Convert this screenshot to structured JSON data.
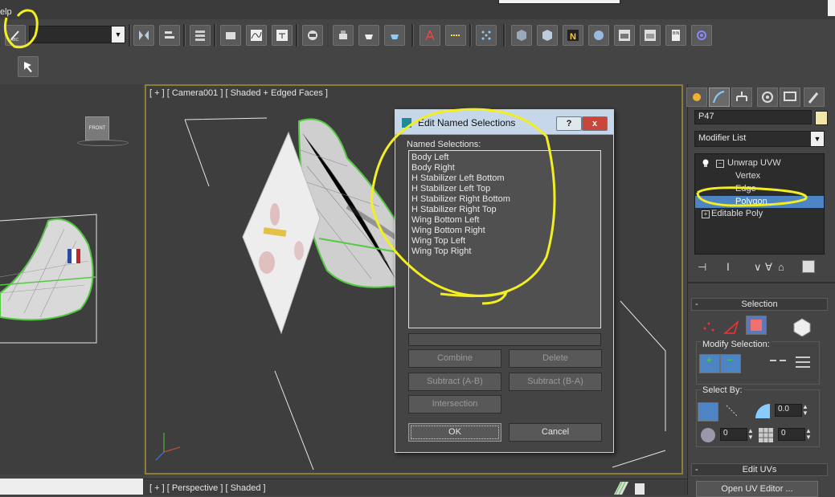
{
  "menubar": {
    "help_fragment": "elp"
  },
  "toolbar": {
    "selection_set_value": "",
    "icons": [
      "named-selection-sets-icon",
      "mirror-icon",
      "align-icon",
      "layer-manager-icon",
      "scene-explorer-icon",
      "curve-editor-icon",
      "schematic-view-icon",
      "material-editor-icon",
      "render-setup-icon",
      "rendered-frame-icon",
      "render-icon",
      "active-shade-icon",
      "measure-icon",
      "ruler-icon",
      "dots-icon",
      "mxs-icon",
      "mxs2-icon",
      "n-icon",
      "sphere-icon",
      "mxw-icon",
      "mxw2-icon",
      "bin-icon",
      "gear-icon"
    ]
  },
  "viewport": {
    "label": "[ + ] [ Camera001 ] [ Shaded + Edged Faces ]",
    "viewcube_label": "FRONT"
  },
  "bottom_viewport": {
    "label": "[ + ] [ Perspective ] [ Shaded ]"
  },
  "dialog": {
    "title": "Edit Named Selections",
    "help_btn": "?",
    "close_btn": "x",
    "list_label": "Named Selections:",
    "items": [
      "Body Left",
      "Body Right",
      "H Stabilizer Left Bottom",
      "H Stabilizer Left Top",
      "H Stabilizer Right Bottom",
      "H Stabilizer Right Top",
      "Wing Bottom Left",
      "Wing Bottom Right",
      "Wing Top Left",
      "Wing Top Right"
    ],
    "name_field": "",
    "buttons": {
      "combine": "Combine",
      "delete": "Delete",
      "subtract_ab": "Subtract (A-B)",
      "subtract_ba": "Subtract (B-A)",
      "intersection": "Intersection",
      "ok": "OK",
      "cancel": "Cancel"
    }
  },
  "command_panel": {
    "object_name": "P47",
    "object_color": "#f0e6a8",
    "modifier_list": "Modifier List",
    "stack": [
      {
        "label": "Unwrap UVW",
        "level": 0
      },
      {
        "label": "Vertex",
        "level": 1
      },
      {
        "label": "Edge",
        "level": 1
      },
      {
        "label": "Polygon",
        "level": 1,
        "selected": true
      },
      {
        "label": "Editable Poly",
        "level": 0
      }
    ],
    "selection_rollout": "Selection",
    "modify_selection_label": "Modify Selection:",
    "select_by_label": "Select By:",
    "spinner1": "0.0",
    "spinner2": "0",
    "spinner3": "0",
    "edit_uvs_rollout": "Edit UVs",
    "open_uv_editor": "Open UV Editor ..."
  },
  "colors": {
    "selection_highlight": "#4c84c4",
    "annotation_yellow": "#f2ee22",
    "dialog_titlebar": "#c5d7e8"
  }
}
